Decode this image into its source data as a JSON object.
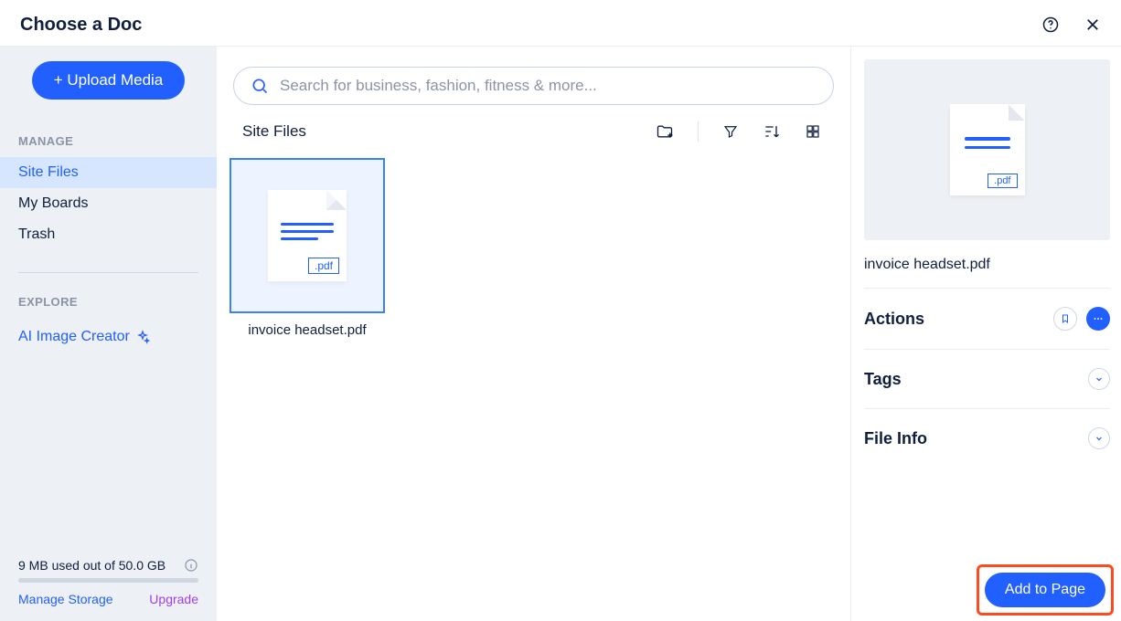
{
  "header": {
    "title": "Choose a Doc"
  },
  "sidebar": {
    "upload_label": "+ Upload Media",
    "manage_label": "MANAGE",
    "items": [
      {
        "label": "Site Files",
        "active": true
      },
      {
        "label": "My Boards",
        "active": false
      },
      {
        "label": "Trash",
        "active": false
      }
    ],
    "explore_label": "EXPLORE",
    "explore_items": [
      {
        "label": "AI Image Creator"
      }
    ],
    "storage": {
      "used_text": "9 MB used out of 50.0 GB",
      "manage_link": "Manage Storage",
      "upgrade_link": "Upgrade"
    }
  },
  "search": {
    "placeholder": "Search for business, fashion, fitness & more..."
  },
  "toolbar": {
    "title": "Site Files"
  },
  "files": [
    {
      "name": "invoice headset.pdf",
      "ext": ".pdf",
      "selected": true
    }
  ],
  "preview": {
    "name": "invoice headset.pdf",
    "ext": ".pdf",
    "sections": {
      "actions": "Actions",
      "tags": "Tags",
      "fileinfo": "File Info"
    }
  },
  "footer": {
    "add_label": "Add to Page"
  }
}
